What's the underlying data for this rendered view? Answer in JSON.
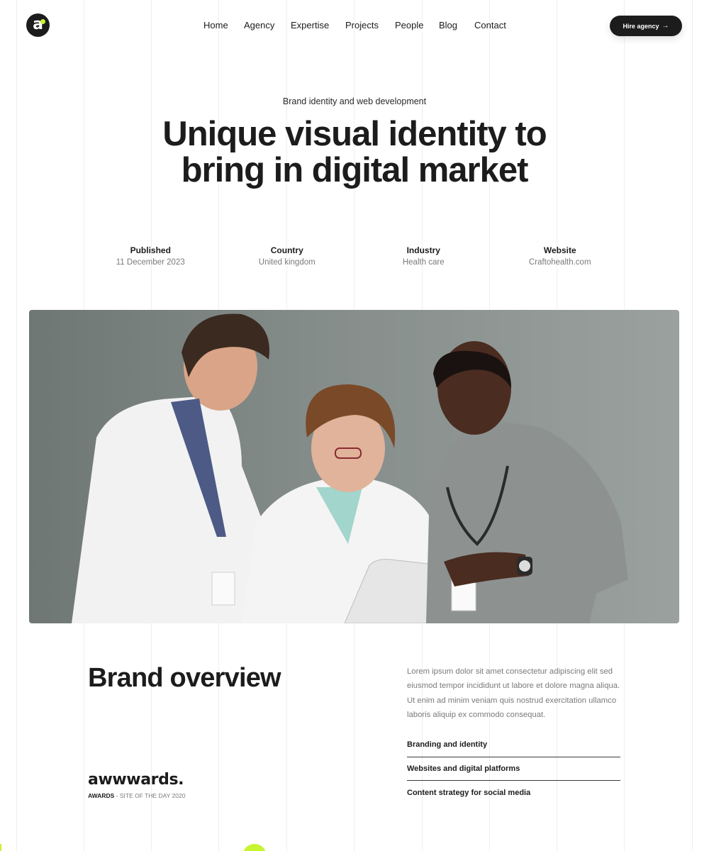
{
  "header": {
    "logo_letter": "a",
    "nav": [
      "Home",
      "Agency",
      "Expertise",
      "Projects",
      "People",
      "Blog",
      "Contact"
    ],
    "cta_label": "Hire agency"
  },
  "hero": {
    "eyebrow": "Brand identity and web development",
    "title_line1": "Unique visual identity to",
    "title_line2": "bring in digital market"
  },
  "meta": [
    {
      "label": "Published",
      "value": "11 December 2023"
    },
    {
      "label": "Country",
      "value": "United kingdom"
    },
    {
      "label": "Industry",
      "value": "Health care"
    },
    {
      "label": "Website",
      "value": "Craftohealth.com"
    }
  ],
  "overview": {
    "title": "Brand overview",
    "text": "Lorem ipsum dolor sit amet consectetur adipiscing elit sed eiusmod tempor incididunt ut labore et dolore magna aliqua. Ut enim ad minim veniam quis nostrud exercitation ullamco laboris aliquip ex commodo consequat.",
    "services": [
      "Branding and identity",
      "Websites and digital platforms",
      "Content strategy for social media"
    ]
  },
  "award": {
    "logo": "awwwards.",
    "caption_bold": "AWARDS",
    "caption_rest": " - SITE OF THE DAY 2020"
  },
  "colors": {
    "accent": "#c6f432",
    "dark": "#1c1c1c",
    "muted": "#7a7a7a"
  }
}
